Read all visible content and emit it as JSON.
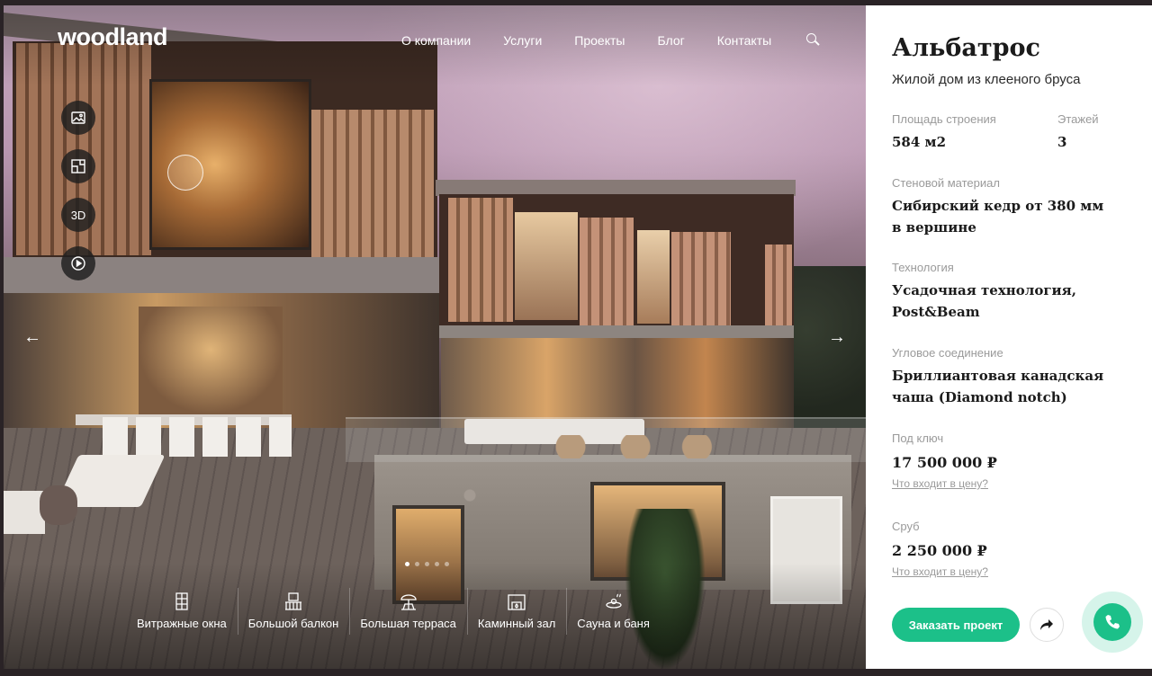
{
  "brand": {
    "logo": "woodland"
  },
  "nav": {
    "items": [
      "О компании",
      "Услуги",
      "Проекты",
      "Блог",
      "Контакты"
    ]
  },
  "side_tools": {
    "tour_3d_label": "3D"
  },
  "slider": {
    "slides_total": 5,
    "active_slide": 1
  },
  "features": [
    {
      "icon": "window-icon",
      "label": "Витражные окна"
    },
    {
      "icon": "balcony-icon",
      "label": "Большой балкон"
    },
    {
      "icon": "terrace-icon",
      "label": "Большая терраса"
    },
    {
      "icon": "fireplace-icon",
      "label": "Каминный зал"
    },
    {
      "icon": "sauna-icon",
      "label": "Сауна и баня"
    }
  ],
  "project": {
    "title": "Альбатрос",
    "subtitle": "Жилой дом из клееного бруса",
    "specs": {
      "area_label": "Площадь строения",
      "area_value": "584 м2",
      "floors_label": "Этажей",
      "floors_value": "3",
      "wall_label": "Стеновой материал",
      "wall_value": "Сибирский кедр от 380 мм в вершине",
      "tech_label": "Технология",
      "tech_value": "Усадочная технология, Post&Beam",
      "corner_label": "Угловое соединение",
      "corner_value": "Бриллиантовая канадская чаша (Diamond notch)"
    },
    "prices": {
      "turnkey_label": "Под ключ",
      "turnkey_value": "17 500 000 ₽",
      "turnkey_link": "Что входит в цену?",
      "frame_label": "Сруб",
      "frame_value": "2 250 000 ₽",
      "frame_link": "Что входит в цену?"
    },
    "order_button": "Заказать проект"
  },
  "colors": {
    "accent": "#1cc089",
    "panel_bg": "#ffffff",
    "text_dark": "#1b1b1b",
    "text_muted": "#9a9a9a"
  }
}
